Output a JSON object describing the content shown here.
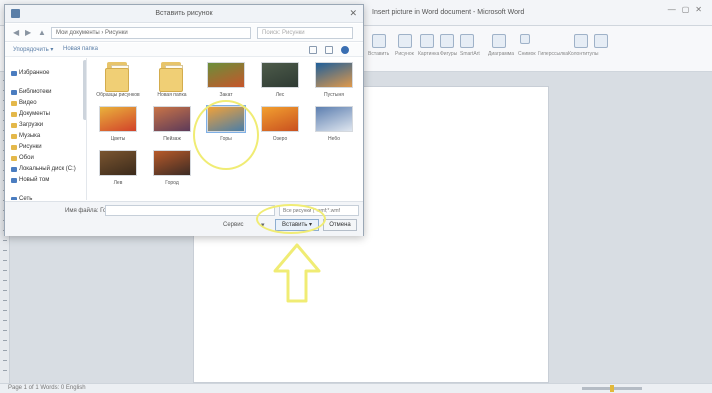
{
  "word": {
    "title": "Insert picture in Word document - Microsoft Word",
    "status_left": "Page 1 of 1   Words: 0   English"
  },
  "dialog": {
    "title": "Вставить рисунок",
    "address": "Мои документы › Рисунки",
    "search_placeholder": "Поиск: Рисунки",
    "toolbar": {
      "organize": "Упорядочить ▾",
      "new_folder": "Новая папка"
    },
    "sidebar": [
      {
        "label": "Избранное",
        "icon": "star"
      },
      {
        "label": "Библиотеки",
        "icon": "library"
      },
      {
        "label": "Видео",
        "icon": "folder"
      },
      {
        "label": "Документы",
        "icon": "folder"
      },
      {
        "label": "Загрузки",
        "icon": "folder"
      },
      {
        "label": "Музыка",
        "icon": "folder"
      },
      {
        "label": "Рисунки",
        "icon": "folder"
      },
      {
        "label": "Обои",
        "icon": "folder"
      },
      {
        "label": "Локальный диск (C:)",
        "icon": "drive"
      },
      {
        "label": "Новый том",
        "icon": "drive"
      },
      {
        "label": "Сеть",
        "icon": "network"
      }
    ],
    "files": [
      {
        "name": "Образцы рисунков",
        "type": "folder"
      },
      {
        "name": "Новая папка",
        "type": "folder"
      },
      {
        "name": "Закат",
        "type": "image",
        "colors": [
          "#6a8f3a",
          "#c7552b"
        ]
      },
      {
        "name": "Лес",
        "type": "image",
        "colors": [
          "#4d5b4a",
          "#2e3a33"
        ]
      },
      {
        "name": "Пустыня",
        "type": "image",
        "colors": [
          "#1f5f9a",
          "#e0994b"
        ]
      },
      {
        "name": "Цветы",
        "type": "image",
        "colors": [
          "#e9b23c",
          "#d2422a"
        ]
      },
      {
        "name": "Пейзаж",
        "type": "image",
        "colors": [
          "#c97447",
          "#5d3a59"
        ]
      },
      {
        "name": "Горы",
        "type": "image",
        "colors": [
          "#f0a13a",
          "#4a7ea8"
        ],
        "selected": true
      },
      {
        "name": "Озеро",
        "type": "image",
        "colors": [
          "#f2a030",
          "#c9501f"
        ]
      },
      {
        "name": "Небо",
        "type": "image",
        "colors": [
          "#5d7fb0",
          "#dfe6ef"
        ]
      },
      {
        "name": "Лев",
        "type": "image",
        "colors": [
          "#7a5530",
          "#3b2a1b"
        ]
      },
      {
        "name": "Город",
        "type": "image",
        "colors": [
          "#b75a2a",
          "#3d2b24"
        ]
      }
    ],
    "filename_label": "Имя файла: Горы",
    "filetype": "Все рисунки (*.emf;*.wmf",
    "tools_label": "Сервис",
    "insert_label": "Вставить ▾",
    "cancel_label": "Отмена"
  },
  "ribbon": {
    "labels": [
      "Вставить",
      "Рисунок",
      "Картинка",
      "Фигуры",
      "SmartArt",
      "Диаграмма",
      "Снимок",
      "Гиперссылка",
      "Закладка",
      "Колонтитулы",
      "Номер стр."
    ]
  },
  "annotation_color": "#f0ec74"
}
